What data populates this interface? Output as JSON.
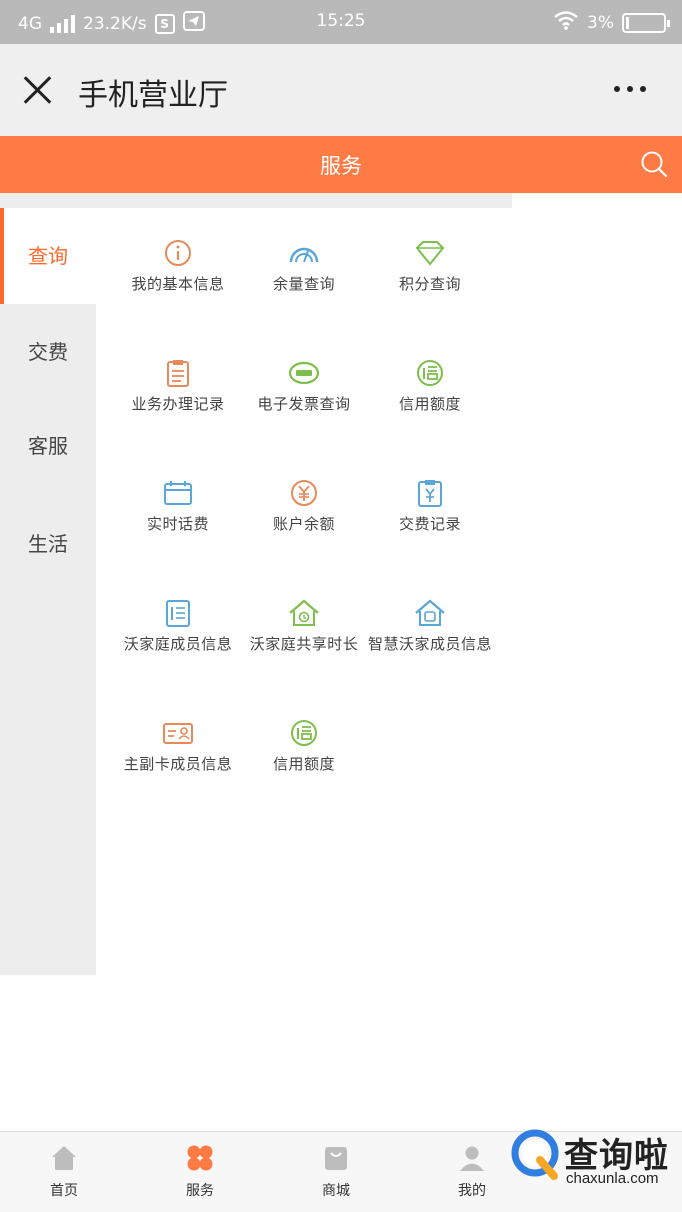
{
  "status_bar": {
    "network": "4G",
    "speed": "23.2K/s",
    "s_badge": "S",
    "time": "15:25",
    "battery": "3%"
  },
  "title_bar": {
    "title": "手机营业厅"
  },
  "header": {
    "title": "服务"
  },
  "side_menu": {
    "items": [
      {
        "label": "查询"
      },
      {
        "label": "交费"
      },
      {
        "label": "客服"
      },
      {
        "label": "生活"
      }
    ]
  },
  "services": [
    {
      "label": "我的基本信息",
      "icon": "info-circle-icon",
      "color": "#e8895a"
    },
    {
      "label": "余量查询",
      "icon": "gauge-icon",
      "color": "#5aa6d9"
    },
    {
      "label": "积分查询",
      "icon": "diamond-icon",
      "color": "#7dbf4c"
    },
    {
      "label": "业务办理记录",
      "icon": "clipboard-icon",
      "color": "#e8895a"
    },
    {
      "label": "电子发票查询",
      "icon": "invoice-cloud-icon",
      "color": "#7dbf4c"
    },
    {
      "label": "信用额度",
      "icon": "credit-icon",
      "color": "#7dbf4c"
    },
    {
      "label": "实时话费",
      "icon": "calendar-icon",
      "color": "#5aa6d9"
    },
    {
      "label": "账户余额",
      "icon": "yuan-circle-icon",
      "color": "#e8895a"
    },
    {
      "label": "交费记录",
      "icon": "yuan-clipboard-icon",
      "color": "#5aa6d9"
    },
    {
      "label": "沃家庭成员信息",
      "icon": "member-list-icon",
      "color": "#5aa6d9"
    },
    {
      "label": "沃家庭共享时长",
      "icon": "home-clock-icon",
      "color": "#7dbf4c"
    },
    {
      "label": "智慧沃家成员信息",
      "icon": "smart-home-icon",
      "color": "#5aa6d9"
    },
    {
      "label": "主副卡成员信息",
      "icon": "id-card-icon",
      "color": "#e8895a"
    },
    {
      "label": "信用额度",
      "icon": "credit-icon",
      "color": "#7dbf4c"
    }
  ],
  "bottom_nav": {
    "items": [
      {
        "label": "首页",
        "icon": "home-icon"
      },
      {
        "label": "服务",
        "icon": "service-grid-icon"
      },
      {
        "label": "商城",
        "icon": "shop-bag-icon"
      },
      {
        "label": "我的",
        "icon": "user-icon"
      }
    ]
  },
  "watermark": {
    "text": "查询啦",
    "domain": "chaxunla.com"
  },
  "colors": {
    "accent": "#ff7b45",
    "active_text": "#ff6a2b",
    "side_bg": "#ededed"
  }
}
